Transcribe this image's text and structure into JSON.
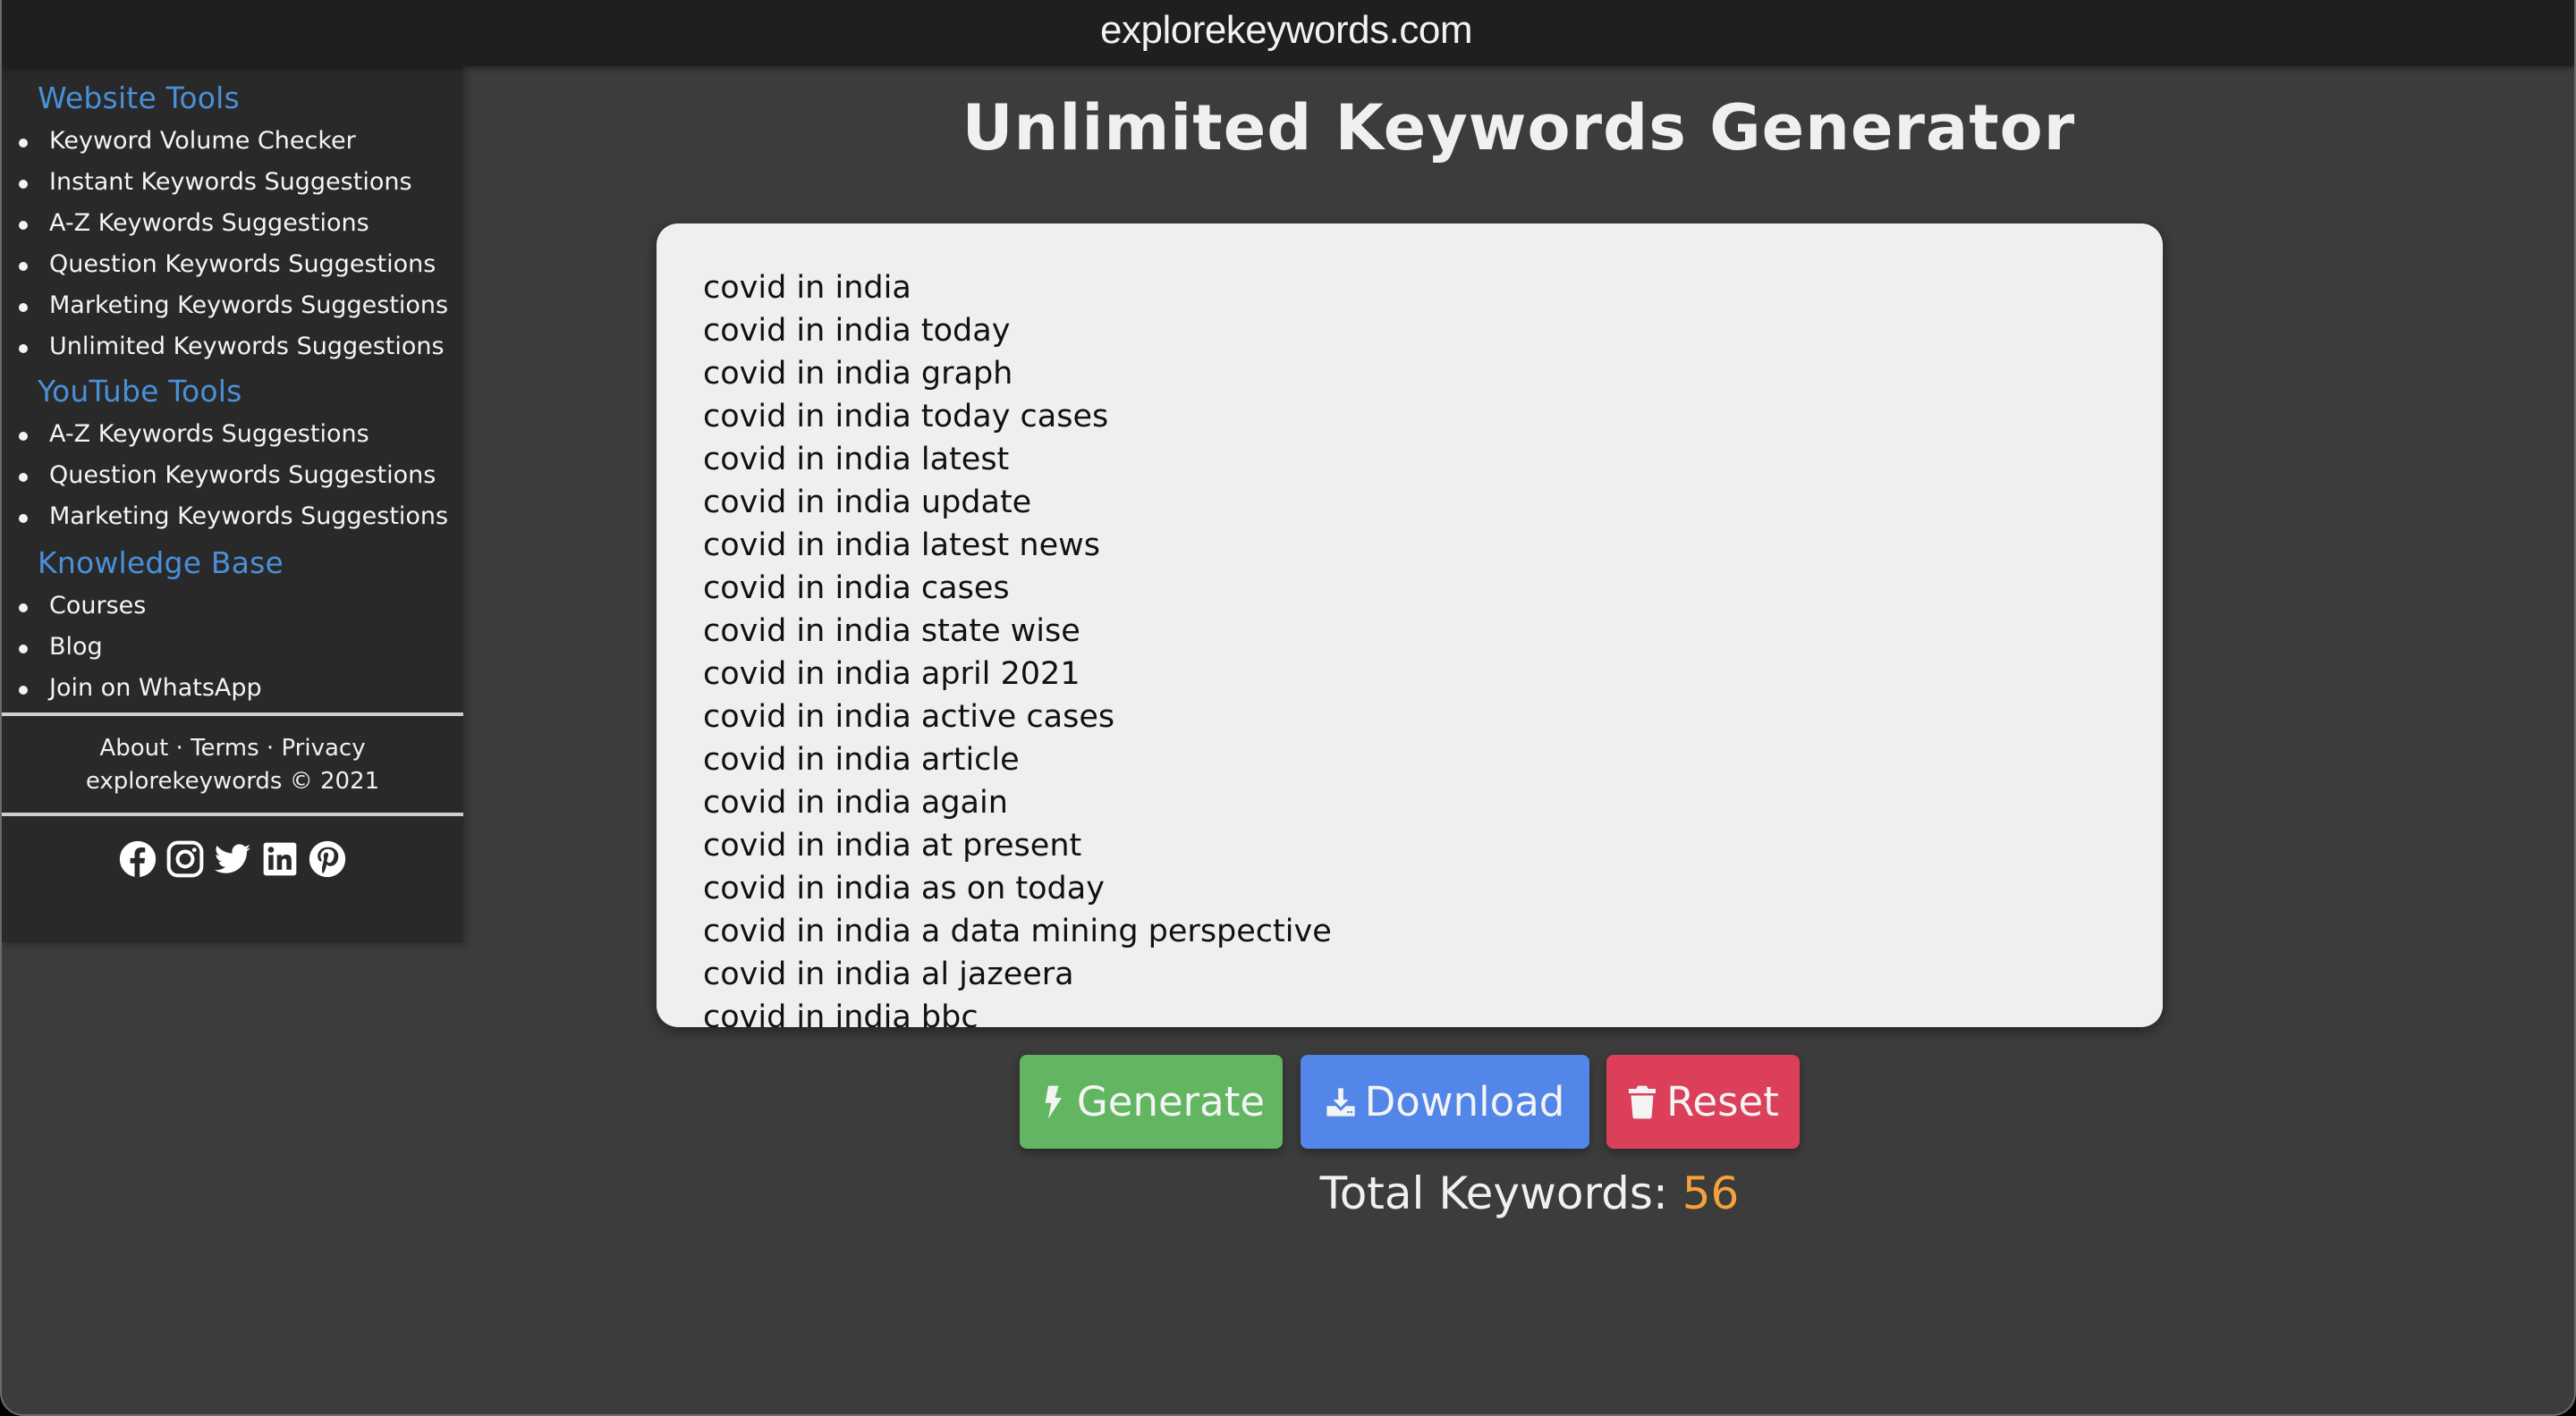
{
  "header": {
    "site_title": "explorekeywords.com"
  },
  "sidebar": {
    "sections": [
      {
        "heading": "Website Tools",
        "items": [
          {
            "label": "Keyword Volume Checker"
          },
          {
            "label": "Instant Keywords Suggestions"
          },
          {
            "label": "A-Z Keywords Suggestions"
          },
          {
            "label": "Question Keywords Suggestions"
          },
          {
            "label": "Marketing Keywords Suggestions"
          },
          {
            "label": "Unlimited Keywords Suggestions"
          }
        ]
      },
      {
        "heading": "YouTube Tools",
        "items": [
          {
            "label": "A-Z Keywords Suggestions"
          },
          {
            "label": "Question Keywords Suggestions"
          },
          {
            "label": "Marketing Keywords Suggestions"
          }
        ]
      },
      {
        "heading": "Knowledge Base",
        "items": [
          {
            "label": "Courses"
          },
          {
            "label": "Blog"
          },
          {
            "label": "Join on WhatsApp"
          }
        ]
      }
    ],
    "footer": {
      "about": "About",
      "terms": "Terms",
      "privacy": "Privacy",
      "separator": " · ",
      "copyright": "explorekeywords © 2021"
    },
    "social": [
      {
        "name": "facebook-icon"
      },
      {
        "name": "instagram-icon"
      },
      {
        "name": "twitter-icon"
      },
      {
        "name": "linkedin-icon"
      },
      {
        "name": "pinterest-icon"
      }
    ]
  },
  "main": {
    "title": "Unlimited Keywords Generator",
    "keywords": [
      "covid in india",
      "covid in india today",
      "covid in india graph",
      "covid in india today cases",
      "covid in india latest",
      "covid in india update",
      "covid in india latest news",
      "covid in india cases",
      "covid in india state wise",
      "covid in india april 2021",
      "covid in india active cases",
      "covid in india article",
      "covid in india again",
      "covid in india at present",
      "covid in india as on today",
      "covid in india a data mining perspective",
      "covid in india al jazeera",
      "covid in india bbc"
    ],
    "buttons": {
      "generate": {
        "label": "Generate",
        "icon": "bolt-icon",
        "color": "#62b662"
      },
      "download": {
        "label": "Download",
        "icon": "download-icon",
        "color": "#5286e8"
      },
      "reset": {
        "label": "Reset",
        "icon": "trash-icon",
        "color": "#dc3f5a"
      }
    },
    "total": {
      "label": "Total Keywords:",
      "count": "56",
      "count_color": "#f4a23a"
    }
  },
  "colors": {
    "header_bg": "#1f1f1f",
    "sidebar_bg": "#292929",
    "main_bg": "#3c3c3c",
    "heading_accent": "#4a90d9",
    "textarea_bg": "#efefef"
  }
}
